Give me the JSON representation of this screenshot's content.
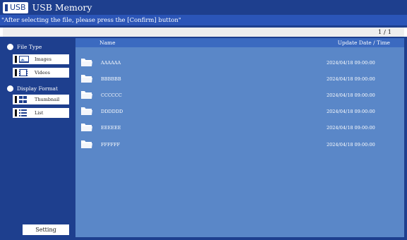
{
  "titlebar": {
    "badge": "USB",
    "title": "USB Memory"
  },
  "instruction": "\"After selecting the file, please press the [Confirm] button\"",
  "pager": {
    "text": "1 / 1"
  },
  "sidebar": {
    "file_type_title": "File Type",
    "images_label": "Images",
    "videos_label": "Videos",
    "display_format_title": "Display Format",
    "thumbnail_label": "Thumbnail",
    "list_label": "List",
    "setting_label": "Setting"
  },
  "table": {
    "name_header": "Name",
    "date_header": "Update Date / Time",
    "rows": [
      {
        "name": "AAAAAA",
        "date": "2024/04/18  09:00:00"
      },
      {
        "name": "BBBBBB",
        "date": "2024/04/18  09:00:00"
      },
      {
        "name": "CCCCCC",
        "date": "2024/04/18  09:00:00"
      },
      {
        "name": "DDDDDD",
        "date": "2024/04/18  09:00:00"
      },
      {
        "name": "EEEEEE",
        "date": "2024/04/18  09:00:00"
      },
      {
        "name": "FFFFFF",
        "date": "2024/04/18  09:00:00"
      }
    ]
  },
  "colors": {
    "dark_blue": "#1e3f8e",
    "header_blue": "#2b55b8",
    "content_blue": "#5a87c8"
  },
  "icons": [
    "usb-icon",
    "images-icon",
    "videos-icon",
    "thumbnail-icon",
    "list-icon",
    "folder-icon"
  ]
}
